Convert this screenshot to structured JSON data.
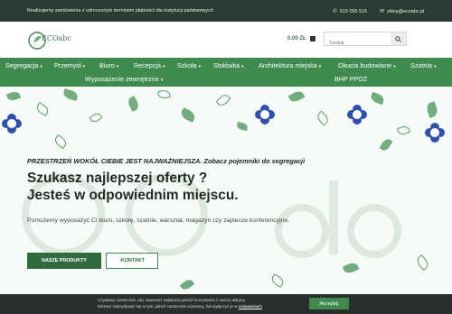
{
  "topbar": {
    "message": "Realizujemy zamówienia z odroczonym terminem płatności dla instytucji państwowych",
    "phone": "515 056 515",
    "email": "sklep@ecoabc.pl",
    "phone_icon": "phone-icon",
    "email_icon": "envelope-icon"
  },
  "header": {
    "logo_text": "ECOabc",
    "cart_total": "0.00 ZŁ",
    "search_placeholder": "Szukaj",
    "search_icon": "search-icon"
  },
  "nav": {
    "items": [
      {
        "label": "Segregacja"
      },
      {
        "label": "Przemysł"
      },
      {
        "label": "Biuro"
      },
      {
        "label": "Recepcja"
      },
      {
        "label": "Szkoła"
      },
      {
        "label": "Stołówka"
      },
      {
        "label": "Architektura miejska"
      },
      {
        "label": "Okucia budowlane"
      },
      {
        "label": "Szatnia"
      },
      {
        "label": "Wyposażenie zewnętrzne"
      },
      {
        "label": "BHP PPOŻ"
      }
    ],
    "caret": "▾"
  },
  "hero": {
    "tagline": "PRZESTRZEŃ WOKÓŁ CIEBIE JEST NAJWAŻNIEJSZA. Zobacz pojemniki do segregacji",
    "headline_line1": "Szukasz najlepszej oferty ?",
    "headline_line2": "Jesteś w odpowiednim miejscu.",
    "sub": "Pomożemy wyposażyć Ci biuro, szkołę, szatnie, warsztat, magazyn czy zaplecze konferencyjne.",
    "btn_products": "NASZE PRODUKTY",
    "btn_contact": "›KONTAKT"
  },
  "cookie": {
    "line1": "Używamy ciasteczek, aby zapewnić najlepszą jakość korzystania z naszej witryny.",
    "line2_prefix": "Możesz zdecydować się w tym, jakich ciasteczek używamy, lub wyłączyć je w",
    "line2_link": "ustawieniach",
    "accept": "Akceptuj"
  },
  "colors": {
    "brand_green": "#3f8b4f",
    "dark_green": "#2f6b3d",
    "topbar": "#2b3a32",
    "flower_blue": "#2f4fb0"
  }
}
